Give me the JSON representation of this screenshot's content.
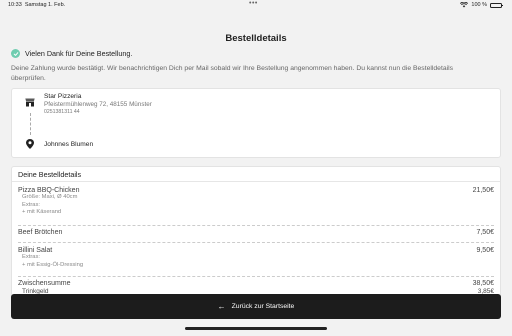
{
  "status_bar": {
    "time": "10:33",
    "date": "Samstag 1. Feb.",
    "dots": "•••",
    "battery_text": "100 %"
  },
  "page": {
    "title": "Bestelldetails"
  },
  "thanks": {
    "text": "Vielen Dank für Deine Bestellung."
  },
  "info": {
    "text": "Deine Zahlung wurde bestätigt. Wir benachrichtigen Dich per Mail sobald wir Ihre Bestellung angenommen haben. Du kannst nun die Bestelldetails überprüfen."
  },
  "restaurant": {
    "name": "Star Pizzeria",
    "address": "Pfeistermühlenweg 72, 48155 Münster",
    "phone": "0251381311 44"
  },
  "customer": {
    "name": "Johnnes Blumen"
  },
  "order": {
    "title": "Deine Bestelldetails",
    "items": [
      {
        "name": "Pizza BBQ-Chicken",
        "price": "21,50€",
        "size_line": "Größe: Maxi, Ø 40cm",
        "extras_label": "Extras:",
        "extra": "+ mit Käserand"
      },
      {
        "name": "Beef Brötchen",
        "price": "7,50€"
      },
      {
        "name": "Billini Salat",
        "price": "9,50€",
        "extras_label": "Extras:",
        "extra": "+ mit Essig-Öl-Dressing"
      }
    ],
    "subtotal_label": "Zwischensumme",
    "subtotal_value": "38,50€",
    "tip_label": "Trinkgeld",
    "tip_value": "3,85€"
  },
  "bottom": {
    "back_label": "Zurück zur Startseite"
  },
  "colors": {
    "check_bg": "#6fcdb0",
    "button_bg": "#1c1c1c"
  }
}
